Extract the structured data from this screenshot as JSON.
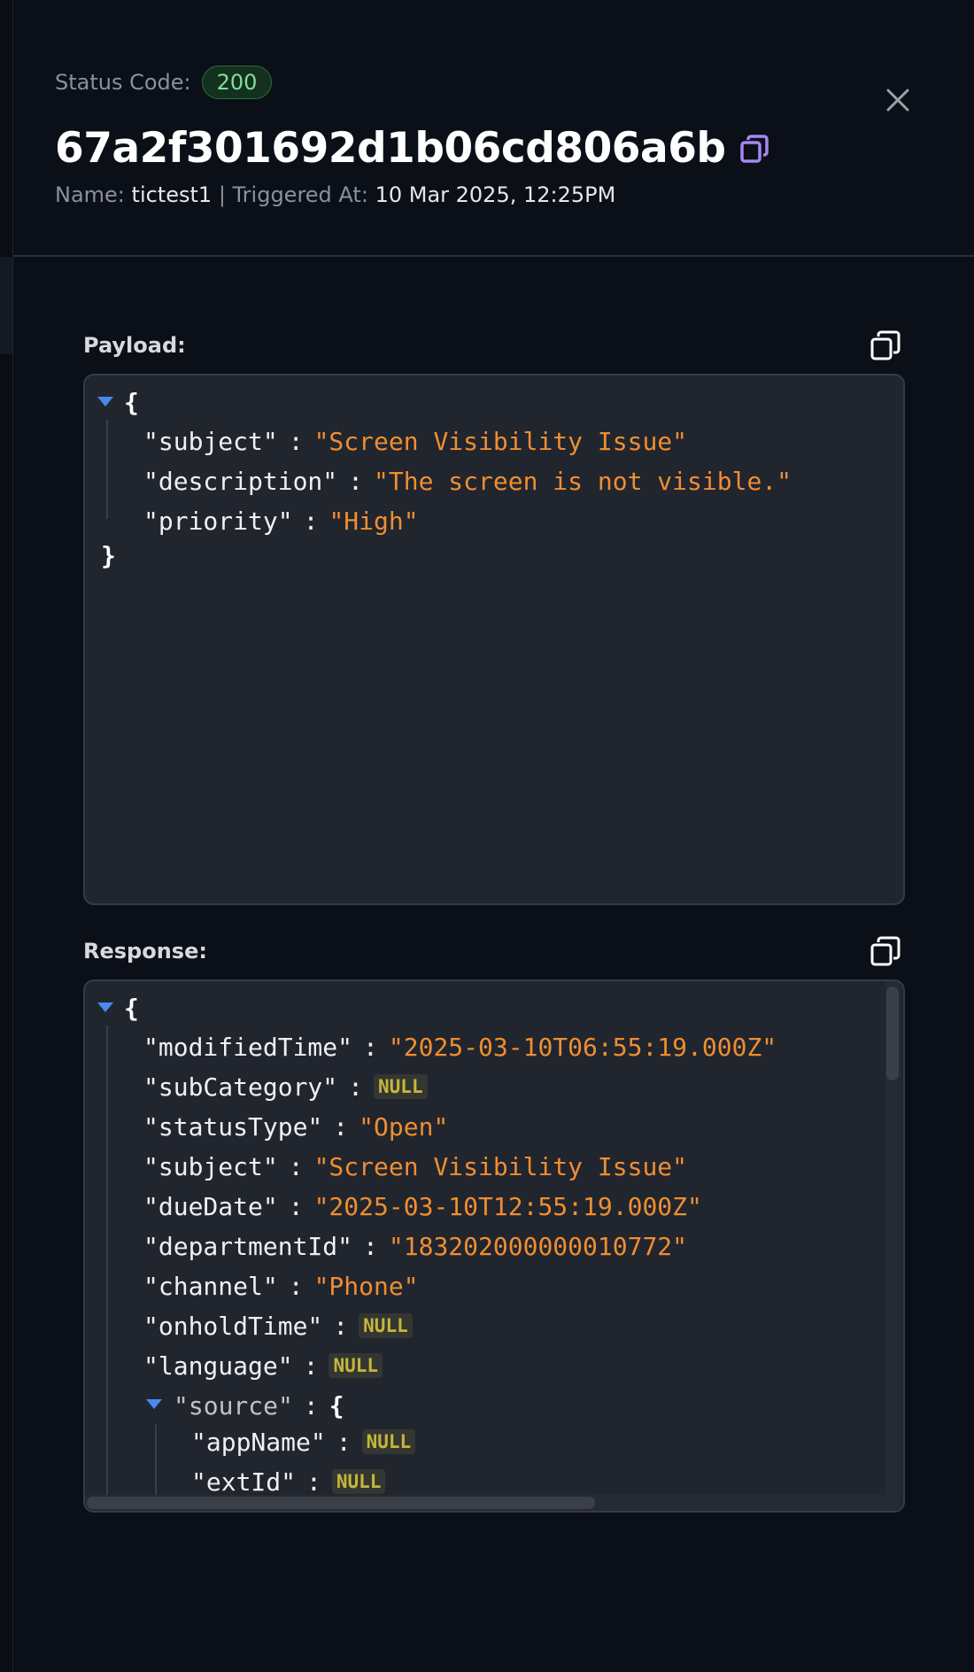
{
  "header": {
    "status_label": "Status Code:",
    "status_code": "200",
    "title": "67a2f301692d1b06cd806a6b",
    "name_label": "Name:",
    "name_value": "tictest1",
    "separator": "|",
    "triggered_label": "Triggered At:",
    "triggered_value": "10 Mar 2025, 12:25PM",
    "copy_icon": "copy-icon",
    "close_icon": "close-icon"
  },
  "payload": {
    "label": "Payload:",
    "open_brace": "{",
    "close_brace": "}",
    "fields": [
      {
        "key": "\"subject\"",
        "sep": ":",
        "value": "\"Screen Visibility Issue\""
      },
      {
        "key": "\"description\"",
        "sep": ":",
        "value": "\"The screen is not visible.\""
      },
      {
        "key": "\"priority\"",
        "sep": ":",
        "value": "\"High\""
      }
    ]
  },
  "response": {
    "label": "Response:",
    "open_brace": "{",
    "fields": [
      {
        "key": "\"modifiedTime\"",
        "sep": ":",
        "value": "\"2025-03-10T06:55:19.000Z\""
      },
      {
        "key": "\"subCategory\"",
        "sep": ":",
        "value": "NULL"
      },
      {
        "key": "\"statusType\"",
        "sep": ":",
        "value": "\"Open\""
      },
      {
        "key": "\"subject\"",
        "sep": ":",
        "value": "\"Screen Visibility Issue\""
      },
      {
        "key": "\"dueDate\"",
        "sep": ":",
        "value": "\"2025-03-10T12:55:19.000Z\""
      },
      {
        "key": "\"departmentId\"",
        "sep": ":",
        "value": "\"183202000000010772\""
      },
      {
        "key": "\"channel\"",
        "sep": ":",
        "value": "\"Phone\""
      },
      {
        "key": "\"onholdTime\"",
        "sep": ":",
        "value": "NULL"
      },
      {
        "key": "\"language\"",
        "sep": ":",
        "value": "NULL"
      }
    ],
    "source": {
      "key": "\"source\"",
      "sep": ":",
      "open_brace": "{",
      "fields": [
        {
          "key": "\"appName\"",
          "sep": ":",
          "value": "NULL"
        },
        {
          "key": "\"extId\"",
          "sep": ":",
          "value": "NULL"
        }
      ]
    }
  },
  "colors": {
    "background": "#0b0f17",
    "code_bg": "#21252e",
    "string": "#ef8e31",
    "null_text": "#c5b73a",
    "status_badge": "#7fe09a",
    "accent_copy": "#a487f0",
    "toggle": "#4a88ee"
  }
}
